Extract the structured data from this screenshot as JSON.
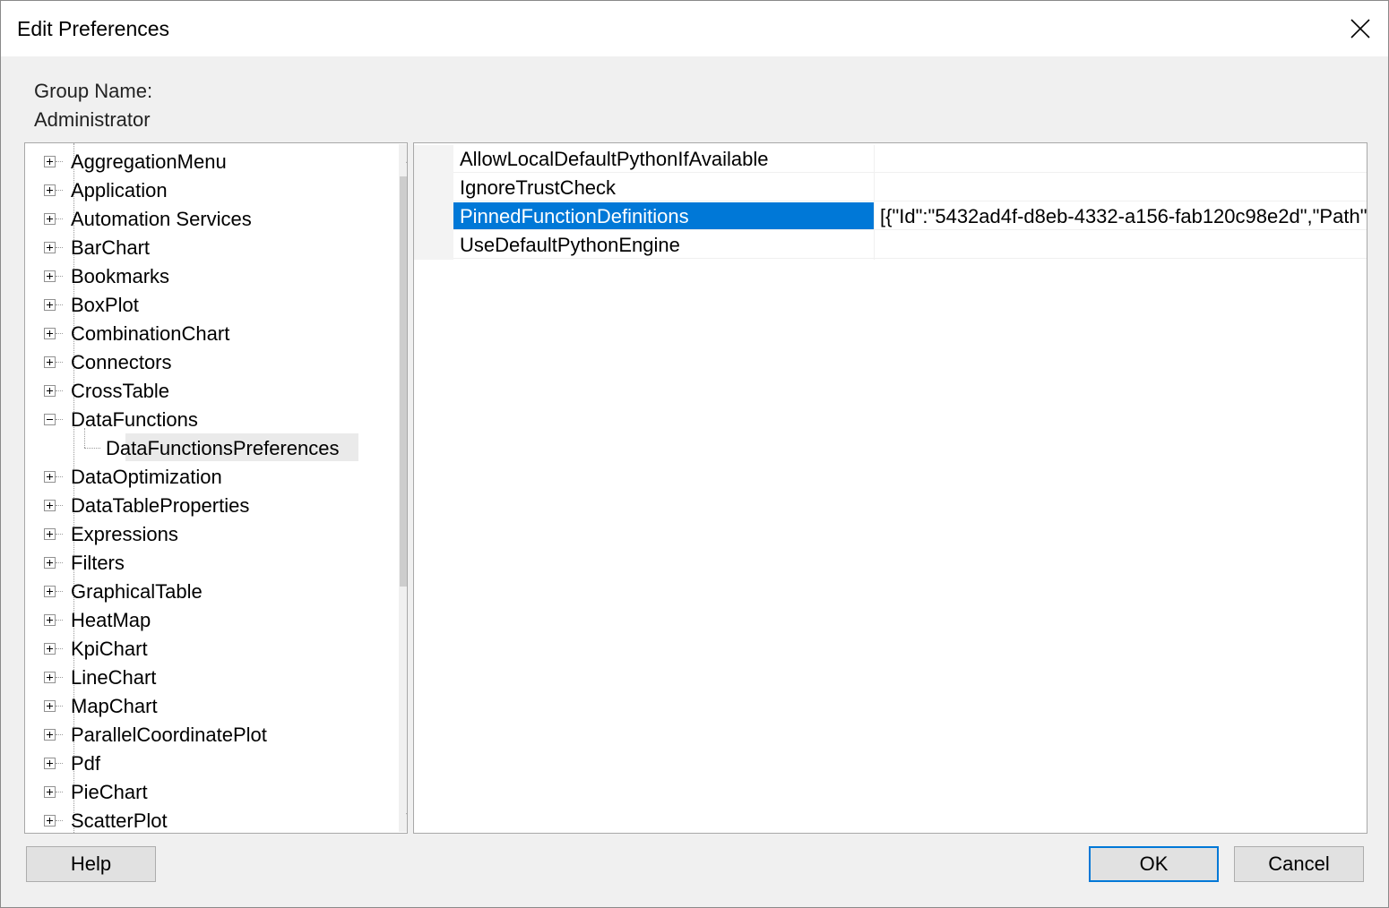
{
  "window": {
    "title": "Edit Preferences"
  },
  "group": {
    "label": "Group Name:",
    "value": "Administrator"
  },
  "tree": {
    "items": [
      {
        "label": "AggregationMenu",
        "expanded": false
      },
      {
        "label": "Application",
        "expanded": false
      },
      {
        "label": "Automation Services",
        "expanded": false
      },
      {
        "label": "BarChart",
        "expanded": false
      },
      {
        "label": "Bookmarks",
        "expanded": false
      },
      {
        "label": "BoxPlot",
        "expanded": false
      },
      {
        "label": "CombinationChart",
        "expanded": false
      },
      {
        "label": "Connectors",
        "expanded": false
      },
      {
        "label": "CrossTable",
        "expanded": false
      },
      {
        "label": "DataFunctions",
        "expanded": true
      },
      {
        "label": "DataFunctionsPreferences",
        "child": true
      },
      {
        "label": "DataOptimization",
        "expanded": false
      },
      {
        "label": "DataTableProperties",
        "expanded": false
      },
      {
        "label": "Expressions",
        "expanded": false
      },
      {
        "label": "Filters",
        "expanded": false
      },
      {
        "label": "GraphicalTable",
        "expanded": false
      },
      {
        "label": "HeatMap",
        "expanded": false
      },
      {
        "label": "KpiChart",
        "expanded": false
      },
      {
        "label": "LineChart",
        "expanded": false
      },
      {
        "label": "MapChart",
        "expanded": false
      },
      {
        "label": "ParallelCoordinatePlot",
        "expanded": false
      },
      {
        "label": "Pdf",
        "expanded": false
      },
      {
        "label": "PieChart",
        "expanded": false
      },
      {
        "label": "ScatterPlot",
        "expanded": false
      }
    ]
  },
  "properties": [
    {
      "name": "AllowLocalDefaultPythonIfAvailable",
      "value": ""
    },
    {
      "name": "IgnoreTrustCheck",
      "value": ""
    },
    {
      "name": "PinnedFunctionDefinitions",
      "value": "[{\"Id\":\"5432ad4f-d8eb-4332-a156-fab120c98e2d\",\"Path\"",
      "selected": true
    },
    {
      "name": "UseDefaultPythonEngine",
      "value": ""
    }
  ],
  "buttons": {
    "help": "Help",
    "ok": "OK",
    "cancel": "Cancel"
  },
  "colors": {
    "selection": "#0078d7",
    "dialog_bg": "#f0f0f0"
  }
}
